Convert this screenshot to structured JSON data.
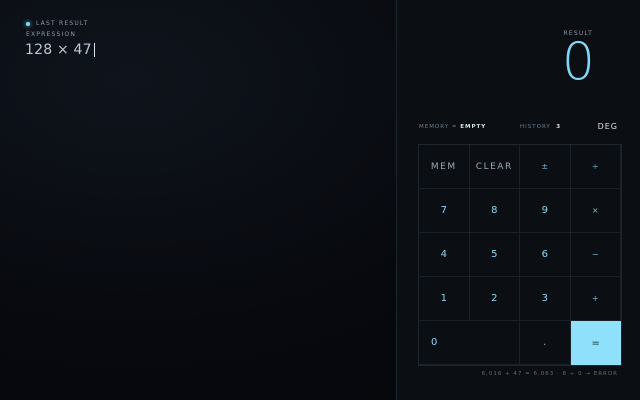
{
  "left": {
    "last_result_label": "LAST RESULT",
    "expression_label": "EXPRESSION",
    "expression_value": "128 × 47"
  },
  "right": {
    "result_label": "RESULT",
    "result_value": "0",
    "memory_prefix": "MEMORY =",
    "memory_value": "EMPTY",
    "history_label": "HISTORY",
    "history_count": "3",
    "angle_mode": "DEG",
    "footer": "6,016 + 47 = 6,063 · 8 ÷ 0 → ERROR"
  },
  "keypad": {
    "mem": "MEM",
    "clear": "CLEAR",
    "plus_minus": "±",
    "divide": "÷",
    "seven": "7",
    "eight": "8",
    "nine": "9",
    "multiply": "×",
    "four": "4",
    "five": "5",
    "six": "6",
    "minus": "−",
    "one": "1",
    "two": "2",
    "three": "3",
    "plus": "+",
    "zero": "0",
    "decimal": ".",
    "equals": "="
  },
  "colors": {
    "accent": "#7fd8f5",
    "equals_bg": "#8fe0fb",
    "background": "#05080d"
  }
}
